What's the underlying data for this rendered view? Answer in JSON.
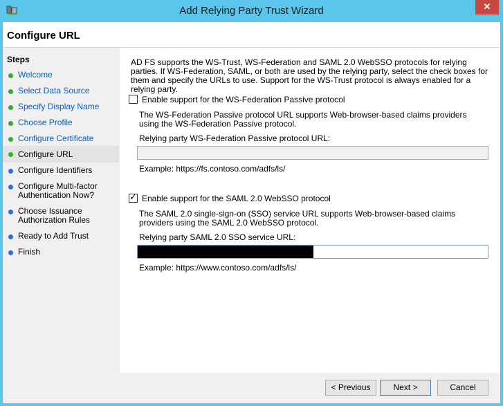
{
  "window": {
    "title": "Add Relying Party Trust Wizard",
    "close_glyph": "✕"
  },
  "header": {
    "title": "Configure URL"
  },
  "steps": {
    "heading": "Steps",
    "items": [
      {
        "label": "Welcome",
        "status": "green"
      },
      {
        "label": "Select Data Source",
        "status": "green"
      },
      {
        "label": "Specify Display Name",
        "status": "green"
      },
      {
        "label": "Choose Profile",
        "status": "green"
      },
      {
        "label": "Configure Certificate",
        "status": "green"
      },
      {
        "label": "Configure URL",
        "status": "green",
        "current": true
      },
      {
        "label": "Configure Identifiers",
        "status": "blue"
      },
      {
        "label": "Configure Multi-factor Authentication Now?",
        "status": "blue"
      },
      {
        "label": "Choose Issuance Authorization Rules",
        "status": "blue"
      },
      {
        "label": "Ready to Add Trust",
        "status": "blue"
      },
      {
        "label": "Finish",
        "status": "blue"
      }
    ]
  },
  "main": {
    "intro": "AD FS supports the WS-Trust, WS-Federation and SAML 2.0 WebSSO protocols for relying parties.  If WS-Federation, SAML, or both are used by the relying party, select the check boxes for them and specify the URLs to use.  Support for the WS-Trust protocol is always enabled for a relying party.",
    "wsfed": {
      "checkbox_label": "Enable support for the WS-Federation Passive protocol",
      "checked": false,
      "description": "The WS-Federation Passive protocol URL supports Web-browser-based claims providers using the WS-Federation Passive protocol.",
      "field_label": "Relying party WS-Federation Passive protocol URL:",
      "value": "",
      "example": "Example: https://fs.contoso.com/adfs/ls/"
    },
    "saml": {
      "checkbox_label": "Enable support for the SAML 2.0 WebSSO protocol",
      "checked": true,
      "check_glyph": "✓",
      "description": "The SAML 2.0 single-sign-on (SSO) service URL supports Web-browser-based claims providers using the SAML 2.0 WebSSO protocol.",
      "field_label": "Relying party SAML 2.0 SSO service URL:",
      "value_redacted": true,
      "example": "Example: https://www.contoso.com/adfs/ls/"
    }
  },
  "footer": {
    "previous_label": "< Previous",
    "next_label": "Next >",
    "cancel_label": "Cancel"
  },
  "colors": {
    "frame": "#5bc6ec",
    "close": "#c7463d",
    "step_done": "#3aa935",
    "step_pending": "#2e6fd6",
    "link": "#0b5fb3"
  }
}
